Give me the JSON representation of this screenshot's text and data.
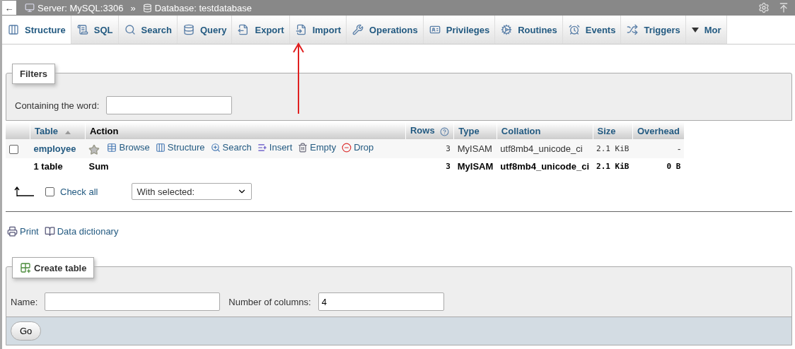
{
  "breadcrumb": {
    "back": "←",
    "server": "Server: MySQL:3306",
    "separator": "»",
    "database": "Database: testdatabase"
  },
  "tabs": [
    {
      "label": "Structure",
      "selected": true,
      "kind": "tab"
    },
    {
      "label": "SQL",
      "selected": false,
      "kind": "tab"
    },
    {
      "label": "Search",
      "selected": false,
      "kind": "tab"
    },
    {
      "label": "Query",
      "selected": false,
      "kind": "tab"
    },
    {
      "label": "Export",
      "selected": false,
      "kind": "tab"
    },
    {
      "label": "Import",
      "selected": false,
      "kind": "tab"
    },
    {
      "label": "Operations",
      "selected": false,
      "kind": "tab"
    },
    {
      "label": "Privileges",
      "selected": false,
      "kind": "tab"
    },
    {
      "label": "Routines",
      "selected": false,
      "kind": "tab"
    },
    {
      "label": "Events",
      "selected": false,
      "kind": "tab"
    },
    {
      "label": "Triggers",
      "selected": false,
      "kind": "tab"
    },
    {
      "label": "Mor",
      "selected": false,
      "kind": "menu"
    }
  ],
  "filters": {
    "legend": "Filters",
    "label": "Containing the word:"
  },
  "table": {
    "columns": [
      "Table",
      "Action",
      "Rows",
      "Type",
      "Collation",
      "Size",
      "Overhead"
    ],
    "rows": [
      {
        "checked": false,
        "name": "employee",
        "favorite": false,
        "actions": [
          "Browse",
          "Structure",
          "Search",
          "Insert",
          "Empty",
          "Drop"
        ],
        "rows": "3",
        "type": "MyISAM",
        "collation": "utf8mb4_unicode_ci",
        "size": "2.1 KiB",
        "overhead": "-"
      }
    ],
    "footer": {
      "name": "1 table",
      "action": "Sum",
      "rows": "3",
      "type": "MyISAM",
      "collation": "utf8mb4_unicode_ci",
      "size": "2.1 KiB",
      "overhead": "0 B"
    }
  },
  "bulk": {
    "check_all": "Check all",
    "checked": false,
    "select": "With selected:"
  },
  "links": [
    "Print",
    "Data dictionary"
  ],
  "create_table": {
    "legend": "Create table",
    "name_label": "Name:",
    "columns_label": "Number of columns:",
    "columns_value": "4",
    "button": "Go"
  }
}
